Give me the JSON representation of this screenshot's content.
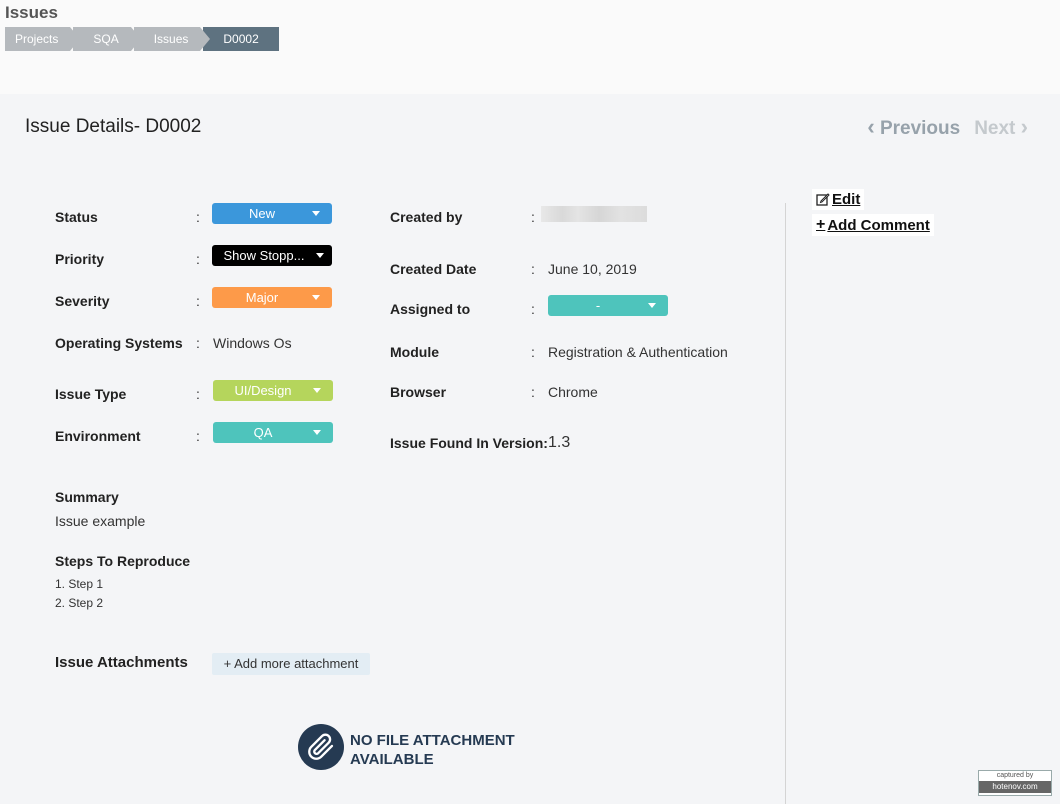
{
  "header": {
    "title": "Issues",
    "breadcrumb": [
      "Projects",
      "SQA",
      "Issues",
      "D0002"
    ]
  },
  "details": {
    "title": "Issue Details- D0002",
    "nav": {
      "previous": "Previous",
      "next": "Next"
    }
  },
  "left_fields": {
    "status": {
      "label": "Status",
      "value": "New",
      "color": "#3b97db"
    },
    "priority": {
      "label": "Priority",
      "value": "Show Stopp...",
      "color": "#000000"
    },
    "severity": {
      "label": "Severity",
      "value": "Major",
      "color": "#fd9a49"
    },
    "operating_systems": {
      "label": "Operating Systems",
      "value": "Windows Os"
    },
    "issue_type": {
      "label": "Issue Type",
      "value": "UI/Design",
      "color": "#b5d55c"
    },
    "environment": {
      "label": "Environment",
      "value": "QA",
      "color": "#4ec4bc"
    }
  },
  "right_fields": {
    "created_by": {
      "label": "Created by",
      "value": ""
    },
    "created_date": {
      "label": "Created Date",
      "value": "June 10, 2019"
    },
    "assigned_to": {
      "label": "Assigned to",
      "value": "-",
      "color": "#4ec4bc"
    },
    "module": {
      "label": "Module",
      "value": "Registration & Authentication"
    },
    "browser": {
      "label": "Browser",
      "value": "Chrome"
    },
    "found_in_version": {
      "label": "Issue Found In Version:",
      "value": "1.3"
    }
  },
  "colon": ":",
  "summary": {
    "label": "Summary",
    "value": "Issue example"
  },
  "steps": {
    "label": "Steps To Reproduce",
    "items": [
      "1. Step 1",
      "2. Step 2"
    ]
  },
  "attachments": {
    "label": "Issue Attachments",
    "add_button": "+ Add more attachment",
    "empty_line1": "NO FILE ATTACHMENT",
    "empty_line2": "AVAILABLE"
  },
  "actions": {
    "edit": "Edit",
    "add_comment": "Add Comment"
  },
  "watermark": {
    "top": "captured by",
    "bottom": "hotenov.com"
  }
}
